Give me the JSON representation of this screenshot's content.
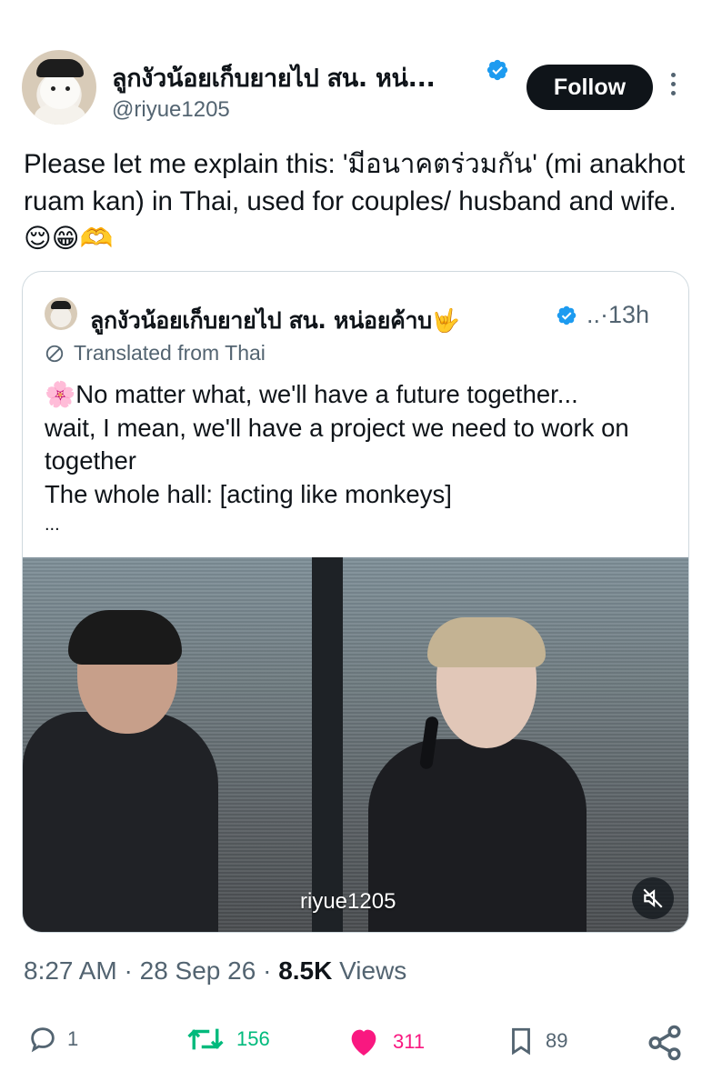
{
  "author": {
    "display_name": "ลูกงัวน้อยเก็บยายไป สน. หน่...",
    "handle": "@riyue1205",
    "follow_label": "Follow"
  },
  "tweet": {
    "text": "Please let me explain this: 'มีอนาคตร่วมกัน' (mi anakhot ruam kan) in Thai, used for couples/ husband and wife. 😌😁🫶"
  },
  "quote": {
    "display_name": "ลูกงัวน้อยเก็บยายไป สน. หน่อยค้าบ🤟",
    "meta": "..·13h",
    "translated_label": "Translated from Thai",
    "lines": [
      "🌸No matter what, we'll have a future together...",
      "wait, I mean, we'll have a project we need to work on together",
      "The whole hall: [acting like monkeys]"
    ],
    "ellipsis": "...",
    "media_watermark": "riyue1205"
  },
  "timestamp": {
    "time": "8:27 AM",
    "sep1": " · ",
    "date": "28 Sep 26",
    "sep2": " · ",
    "views_count": "8.5K",
    "views_label": " Views"
  },
  "actions": {
    "replies": "1",
    "reposts": "156",
    "likes": "311",
    "bookmarks": "89"
  },
  "colors": {
    "text": "#0f1419",
    "secondary": "#536471",
    "verified": "#1d9bf0",
    "repost": "#00ba7c",
    "like": "#f91880"
  },
  "icons": [
    "verified-badge-icon",
    "more-icon",
    "globe-icon",
    "mute-icon",
    "reply-icon",
    "repost-icon",
    "like-icon",
    "bookmark-icon",
    "share-icon"
  ]
}
